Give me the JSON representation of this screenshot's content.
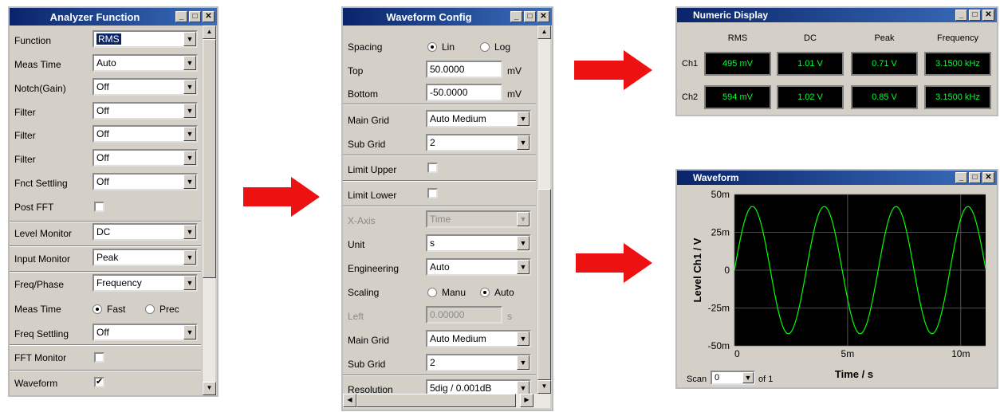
{
  "analyzer": {
    "title": "Analyzer Function",
    "rows": [
      {
        "label": "Function",
        "value": "RMS"
      },
      {
        "label": "Meas Time",
        "value": "Auto"
      },
      {
        "label": "Notch(Gain)",
        "value": "Off"
      },
      {
        "label": "Filter",
        "value": "Off"
      },
      {
        "label": "Filter",
        "value": "Off"
      },
      {
        "label": "Filter",
        "value": "Off"
      },
      {
        "label": "Fnct Settling",
        "value": "Off"
      },
      {
        "label": "Post FFT",
        "value": ""
      },
      {
        "label": "Level Monitor",
        "value": "DC"
      },
      {
        "label": "Input Monitor",
        "value": "Peak"
      },
      {
        "label": "Freq/Phase",
        "value": "Frequency"
      },
      {
        "label": "Meas Time",
        "value": ""
      },
      {
        "label": "Freq Settling",
        "value": "Off"
      },
      {
        "label": "FFT Monitor",
        "value": ""
      },
      {
        "label": "Waveform",
        "value": ""
      }
    ],
    "radio_fast": "Fast",
    "radio_prec": "Prec",
    "waveform_checked": "✔"
  },
  "waveform_config": {
    "title": "Waveform Config",
    "spacing_label": "Spacing",
    "spacing_lin": "Lin",
    "spacing_log": "Log",
    "top_label": "Top",
    "top_value": "50.0000",
    "top_unit": "mV",
    "bottom_label": "Bottom",
    "bottom_value": "-50.0000",
    "bottom_unit": "mV",
    "main_grid_label": "Main Grid",
    "main_grid_value": "Auto Medium",
    "sub_grid_label": "Sub Grid",
    "sub_grid_value": "2",
    "limit_upper_label": "Limit Upper",
    "limit_lower_label": "Limit Lower",
    "xaxis_label": "X-Axis",
    "xaxis_value": "Time",
    "unit_label": "Unit",
    "unit_value": "s",
    "engineering_label": "Engineering",
    "engineering_value": "Auto",
    "scaling_label": "Scaling",
    "scaling_manu": "Manu",
    "scaling_auto": "Auto",
    "left_label": "Left",
    "left_value": "0.00000",
    "left_unit": "s",
    "main_grid2_label": "Main Grid",
    "main_grid2_value": "Auto Medium",
    "sub_grid2_label": "Sub Grid",
    "sub_grid2_value": "2",
    "resolution_label": "Resolution",
    "resolution_value": "5dig / 0.001dB"
  },
  "numeric_display": {
    "title": "Numeric Display",
    "headers": [
      "RMS",
      "DC",
      "Peak",
      "Frequency"
    ],
    "ch1_label": "Ch1",
    "ch2_label": "Ch2",
    "ch1": [
      "495 mV",
      "1.01 V",
      "0.71 V",
      "3.1500 kHz"
    ],
    "ch2": [
      "594 mV",
      "1.02 V",
      "0.85 V",
      "3.1500 kHz"
    ],
    "value_color": "#00ff33"
  },
  "waveform_window": {
    "title": "Waveform",
    "scan_label": "Scan",
    "scan_value": "0",
    "scan_of": "of 1"
  },
  "chart_data": {
    "type": "line",
    "title": "",
    "xlabel": "Time / s",
    "ylabel": "Level Ch1 / V",
    "x_ticks": [
      "0",
      "5m",
      "10m"
    ],
    "y_ticks": [
      "50m",
      "25m",
      "0",
      "-25m",
      "-50m"
    ],
    "xlim": [
      0,
      0.0111
    ],
    "ylim": [
      -0.05,
      0.05
    ],
    "series": [
      {
        "amplitude": 0.042,
        "frequency_hz": 315,
        "color": "#00ff00"
      }
    ],
    "grid": true
  },
  "colors": {
    "accent_red": "#ee1111",
    "title_blue": "#0a246a"
  }
}
